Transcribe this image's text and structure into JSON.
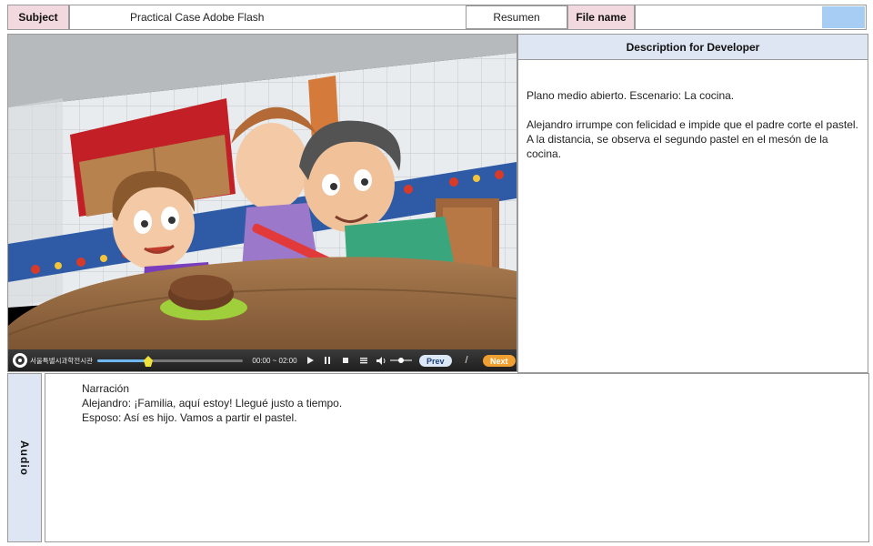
{
  "header": {
    "subject_label": "Subject",
    "subject_value": "Practical Case Adobe Flash",
    "section_value": "Resumen",
    "file_name_label": "File name",
    "file_name_value": "",
    "accent_color": "#a8cdf5"
  },
  "video": {
    "player_logo_text": "서울특별시과학전시관",
    "progress_fraction": 0.35,
    "time_display": "00:00 ~ 02:00",
    "prev_label": "Prev",
    "separator": "/",
    "next_label": "Next",
    "icons": [
      "play-icon",
      "pause-icon",
      "stop-icon",
      "menu-icon",
      "volume-icon"
    ],
    "volume_fraction": 0.5
  },
  "description": {
    "header": "Description for Developer",
    "paragraphs": [
      "Plano medio abierto. Escenario: La cocina.",
      "Alejandro irrumpe con felicidad e impide que el padre corte el pastel.",
      "A la distancia, se observa el segundo pastel en el mesón de la cocina."
    ]
  },
  "audio": {
    "tab_label": "Audio",
    "lines": [
      "Narración",
      "Alejandro: ¡Familia, aquí estoy! Llegué justo a tiempo.",
      "Esposo: Así es hijo. Vamos a partir el pastel."
    ]
  },
  "colors": {
    "label_pink": "#f2d9df",
    "header_blue": "#dde6f2",
    "prev_pill": "#dce8f5",
    "next_pill": "#f0a030"
  }
}
